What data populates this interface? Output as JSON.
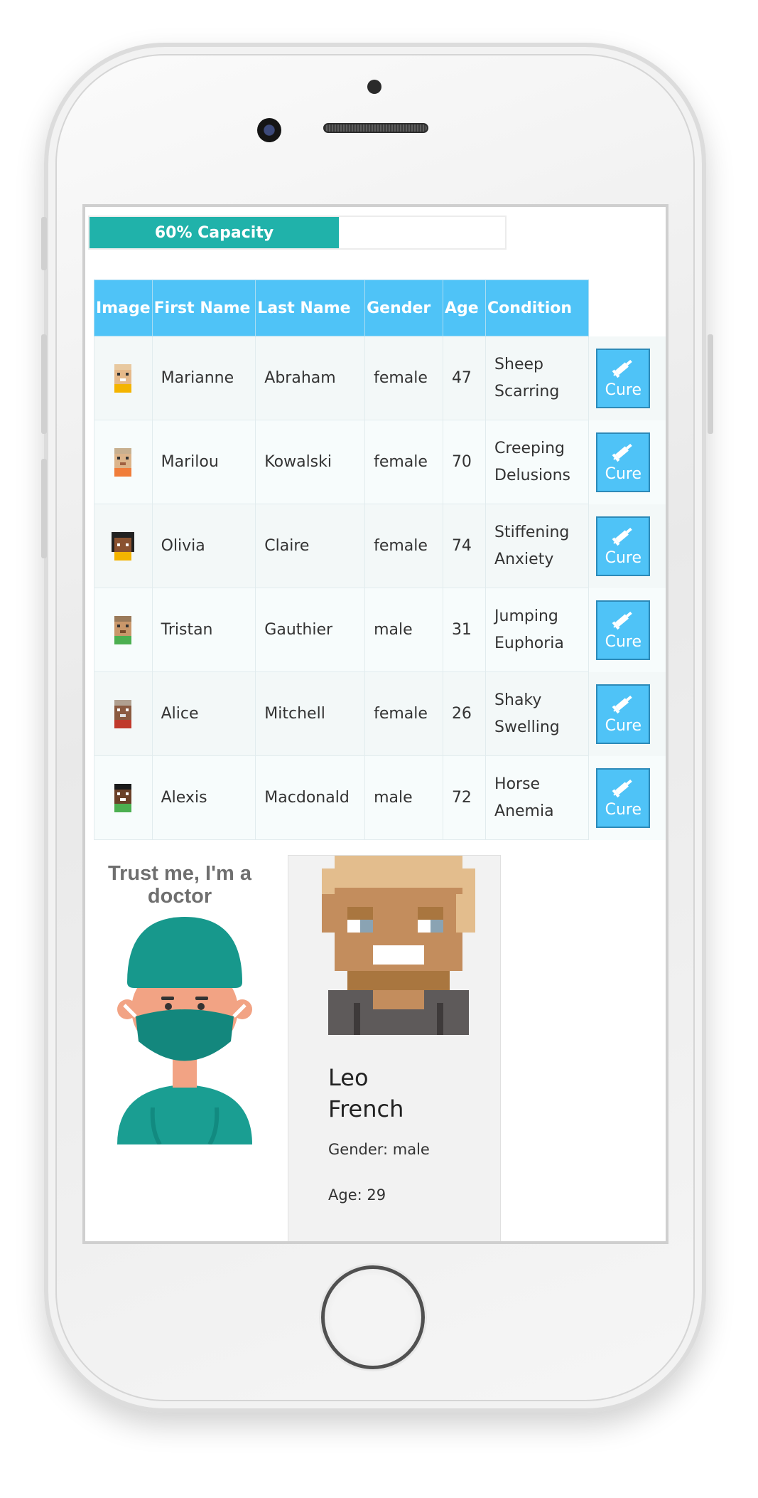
{
  "capacity": {
    "label": "60% Capacity",
    "percent": 60,
    "color": "#20b2aa"
  },
  "table": {
    "headers": [
      "Image",
      "First Name",
      "Last Name",
      "Gender",
      "Age",
      "Condition"
    ],
    "header_color": "#4fc3f7",
    "rows": [
      {
        "first": "Marianne",
        "last": "Abraham",
        "gender": "female",
        "age": "47",
        "condition_line1": "Sheep",
        "condition_line2": "Scarring",
        "avatar": "avatar-icon",
        "action": "Cure"
      },
      {
        "first": "Marilou",
        "last": "Kowalski",
        "gender": "female",
        "age": "70",
        "condition_line1": "Creeping",
        "condition_line2": "Delusions",
        "avatar": "avatar-icon",
        "action": "Cure"
      },
      {
        "first": "Olivia",
        "last": "Claire",
        "gender": "female",
        "age": "74",
        "condition_line1": "Stiffening",
        "condition_line2": "Anxiety",
        "avatar": "avatar-icon",
        "action": "Cure"
      },
      {
        "first": "Tristan",
        "last": "Gauthier",
        "gender": "male",
        "age": "31",
        "condition_line1": "Jumping",
        "condition_line2": "Euphoria",
        "avatar": "avatar-icon",
        "action": "Cure"
      },
      {
        "first": "Alice",
        "last": "Mitchell",
        "gender": "female",
        "age": "26",
        "condition_line1": "Shaky",
        "condition_line2": "Swelling",
        "avatar": "avatar-icon",
        "action": "Cure"
      },
      {
        "first": "Alexis",
        "last": "Macdonald",
        "gender": "male",
        "age": "72",
        "condition_line1": "Horse",
        "condition_line2": "Anemia",
        "avatar": "avatar-icon",
        "action": "Cure"
      }
    ]
  },
  "doctor": {
    "title": "Trust me, I'm a doctor",
    "image": "doctor-icon"
  },
  "selected_patient": {
    "first": "Leo",
    "last": "French",
    "gender_text": "Gender: male",
    "age_text": "Age: 29"
  }
}
